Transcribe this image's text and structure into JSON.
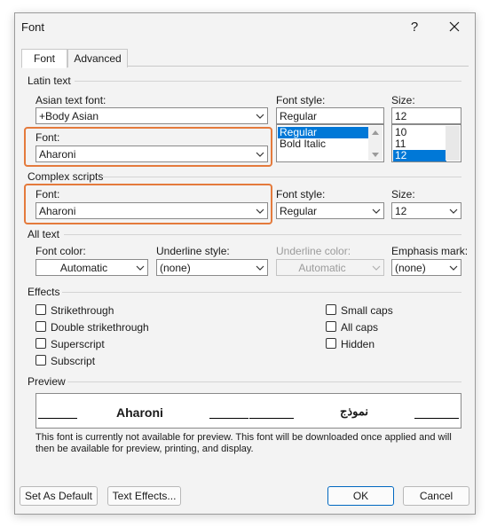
{
  "window": {
    "title": "Font",
    "help_label": "?",
    "close_label": "✕"
  },
  "tabs": [
    {
      "label": "Font",
      "active": true
    },
    {
      "label": "Advanced",
      "active": false
    }
  ],
  "latin": {
    "section": "Latin text",
    "asian_label": "Asian text font:",
    "asian_value": "+Body Asian",
    "font_label": "Font:",
    "font_value": "Aharoni",
    "style_label": "Font style:",
    "style_value": "Regular",
    "style_options": [
      "Regular",
      "Bold Italic"
    ],
    "size_label": "Size:",
    "size_value": "12",
    "size_options": [
      "10",
      "11",
      "12"
    ]
  },
  "complex": {
    "section": "Complex scripts",
    "font_label": "Font:",
    "font_value": "Aharoni",
    "style_label": "Font style:",
    "style_value": "Regular",
    "size_label": "Size:",
    "size_value": "12"
  },
  "alltext": {
    "section": "All text",
    "color_label": "Font color:",
    "color_value": "Automatic",
    "underline_label": "Underline style:",
    "underline_value": "(none)",
    "ucolor_label": "Underline color:",
    "ucolor_value": "Automatic",
    "emphasis_label": "Emphasis mark:",
    "emphasis_value": "(none)"
  },
  "effects": {
    "section": "Effects",
    "strikethrough": "Strikethrough",
    "double": "Double strikethrough",
    "superscript": "Superscript",
    "subscript": "Subscript",
    "smallcaps": "Small caps",
    "allcaps": "All caps",
    "hidden": "Hidden"
  },
  "preview": {
    "section": "Preview",
    "latin_sample": "Aharoni",
    "complex_sample": "نموذج",
    "note": "This font is currently not available for preview. This font will be downloaded once applied and will then be available for preview, printing, and display."
  },
  "buttons": {
    "set_default": "Set As Default",
    "text_effects": "Text Effects...",
    "ok": "OK",
    "cancel": "Cancel"
  },
  "colors": {
    "highlight": "#e47a3c",
    "selection": "#0078d7",
    "ok_border": "#0067c0"
  }
}
